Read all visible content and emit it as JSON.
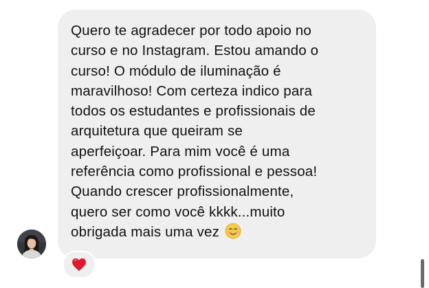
{
  "message": {
    "text": "Quero te agradecer por todo apoio no\ncurso e no Instagram. Estou amando o\ncurso! O módulo de iluminação é\nmaravilhoso! Com certeza indico para\ntodos os estudantes e profissionais de\narquitetura que queiram se\naperfeiçoar. Para mim você é uma\nreferência como profissional e pessoa!\nQuando crescer profissionalmente,\nquero ser como você kkkk...muito\nobrigada mais uma vez",
    "emoji": "smiling-face-icon"
  },
  "sender": {
    "avatar": "profile-photo"
  },
  "reaction": {
    "emoji": "red-heart-icon",
    "color": "#e0192d"
  },
  "colors": {
    "bubble": "#efeff0",
    "text": "#111111",
    "background": "#ffffff"
  }
}
